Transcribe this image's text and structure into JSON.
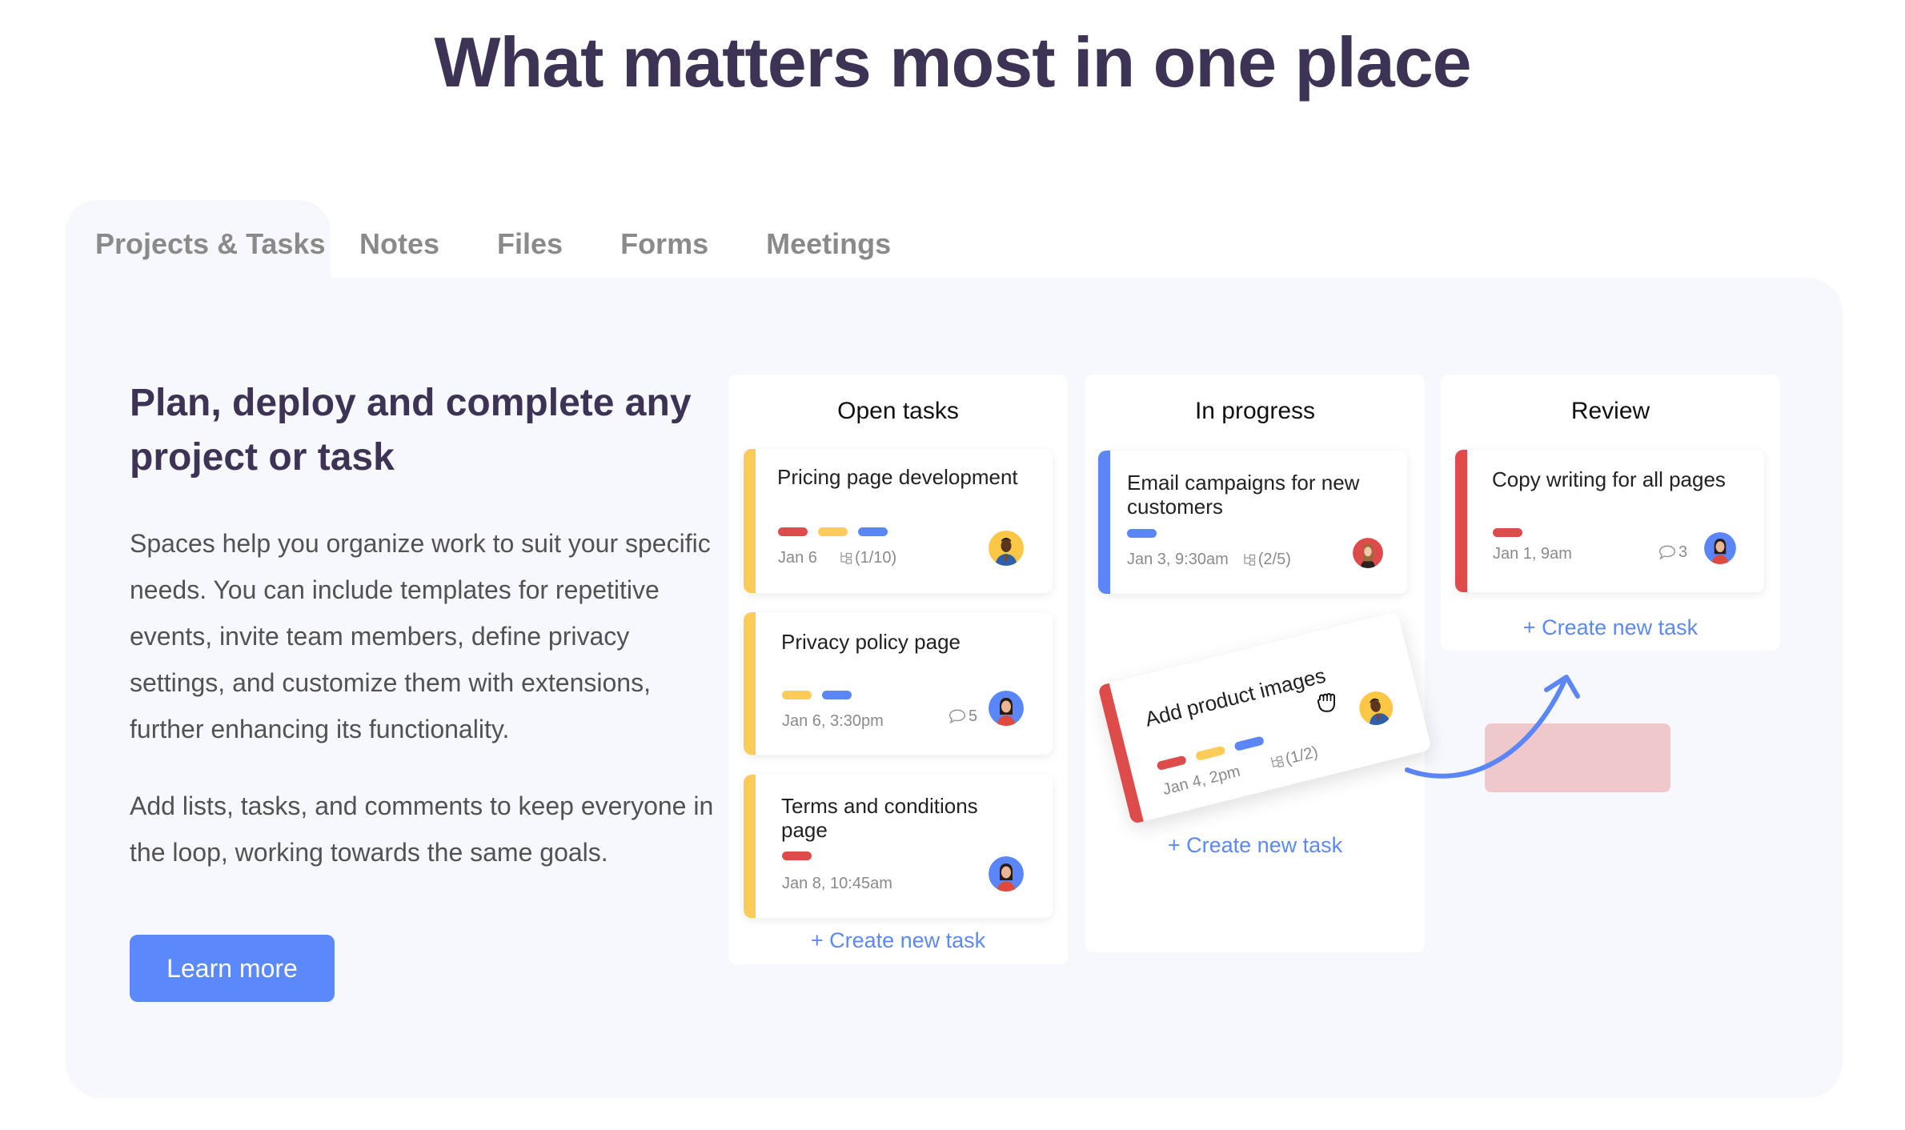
{
  "headline": "What matters most in one place",
  "tabs": [
    {
      "label": "Projects & Tasks",
      "active": true
    },
    {
      "label": "Notes",
      "active": false
    },
    {
      "label": "Files",
      "active": false
    },
    {
      "label": "Forms",
      "active": false
    },
    {
      "label": "Meetings",
      "active": false
    }
  ],
  "feature": {
    "title": "Plan, deploy and complete any project or task",
    "paragraphs": [
      "Spaces help you organize work to suit your specific needs. You can include templates for repetitive events, invite team members, define privacy settings, and customize them with extensions, further enhancing its functionality.",
      "Add lists, tasks, and comments to keep everyone in the loop, working towards the same goals."
    ],
    "button_label": "Learn more"
  },
  "colors": {
    "accent": "#5b88fb",
    "heading": "#3d3354",
    "tag_red": "#de4b4b",
    "tag_yellow": "#fdcb5a",
    "tag_blue": "#5a86f7",
    "drop_zone": "#efc8cc"
  },
  "board": {
    "create_label": "+ Create new task",
    "columns": [
      {
        "title": "Open tasks",
        "cards": [
          {
            "title": "Pricing page development",
            "bar": "yellow",
            "tags": [
              "red",
              "yellow",
              "blue"
            ],
            "date": "Jan 6",
            "subtasks": "(1/10)",
            "comments": null,
            "avatar": "man-yellow"
          },
          {
            "title": "Privacy policy page",
            "bar": "yellow",
            "tags": [
              "yellow",
              "blue"
            ],
            "date": "Jan 6, 3:30pm",
            "subtasks": null,
            "comments": "5",
            "avatar": "woman-blue"
          },
          {
            "title": "Terms and conditions page",
            "bar": "yellow",
            "tags": [
              "red"
            ],
            "date": "Jan 8, 10:45am",
            "subtasks": null,
            "comments": null,
            "avatar": "woman-blue"
          }
        ]
      },
      {
        "title": "In progress",
        "cards": [
          {
            "title": "Email campaigns for new customers",
            "bar": "blue",
            "tags": [
              "blue"
            ],
            "date": "Jan 3, 9:30am",
            "subtasks": "(2/5)",
            "comments": null,
            "avatar": "woman-red"
          },
          {
            "title": "Add product images",
            "bar": "red",
            "tags": [
              "red",
              "yellow",
              "blue"
            ],
            "date": "Jan 4, 2pm",
            "subtasks": "(1/2)",
            "comments": null,
            "avatar": "man-yellow",
            "dragging": true
          }
        ]
      },
      {
        "title": "Review",
        "cards": [
          {
            "title": "Copy writing for all pages",
            "bar": "red",
            "tags": [
              "red"
            ],
            "date": "Jan 1, 9am",
            "subtasks": null,
            "comments": "3",
            "avatar": "woman-blue"
          }
        ]
      }
    ]
  }
}
